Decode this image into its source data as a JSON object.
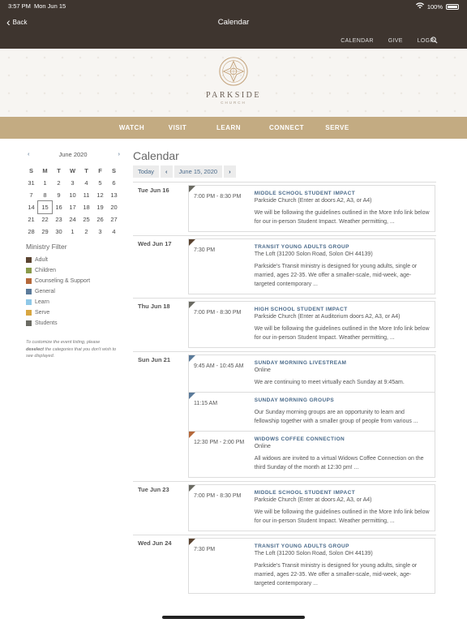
{
  "status": {
    "time": "3:57 PM",
    "date": "Mon Jun 15",
    "battery": "100%"
  },
  "nav": {
    "back_label": "Back",
    "title": "Calendar"
  },
  "toplinks": [
    "CALENDAR",
    "GIVE",
    "LOGIN"
  ],
  "brand": {
    "name": "PARKSIDE",
    "sub": "CHURCH"
  },
  "mainnav": [
    "WATCH",
    "VISIT",
    "LEARN",
    "CONNECT",
    "SERVE"
  ],
  "mini_calendar": {
    "month": "June 2020",
    "dow": [
      "S",
      "M",
      "T",
      "W",
      "T",
      "F",
      "S"
    ],
    "weeks": [
      [
        "31",
        "1",
        "2",
        "3",
        "4",
        "5",
        "6"
      ],
      [
        "7",
        "8",
        "9",
        "10",
        "11",
        "12",
        "13"
      ],
      [
        "14",
        "15",
        "16",
        "17",
        "18",
        "19",
        "20"
      ],
      [
        "21",
        "22",
        "23",
        "24",
        "25",
        "26",
        "27"
      ],
      [
        "28",
        "29",
        "30",
        "1",
        "2",
        "3",
        "4"
      ]
    ],
    "selected": "15"
  },
  "filter": {
    "title": "Ministry Filter",
    "items": [
      {
        "label": "Adult",
        "color": "#5a4330"
      },
      {
        "label": "Children",
        "color": "#8a9a4a"
      },
      {
        "label": "Counseling & Support",
        "color": "#b5683a"
      },
      {
        "label": "General",
        "color": "#5a7a9a"
      },
      {
        "label": "Learn",
        "color": "#8fc8e8"
      },
      {
        "label": "Serve",
        "color": "#d8a640"
      },
      {
        "label": "Students",
        "color": "#6a6a62"
      }
    ],
    "note_before": "To customize the event listing, please ",
    "note_bold": "deselect",
    "note_after": " the categories that you don't wish to see displayed."
  },
  "calendar": {
    "title": "Calendar",
    "today_label": "Today",
    "date_label": "June 15, 2020",
    "days": [
      {
        "label": "Tue Jun 16",
        "events": [
          {
            "time": "7:00 PM - 8:30 PM",
            "name": "MIDDLE SCHOOL STUDENT IMPACT",
            "loc": "Parkside Church (Enter at doors A2, A3, or A4)",
            "desc": "We will be following the guidelines outlined in the More Info link below for our in-person Student Impact. Weather permitting, ...",
            "color": "#6a6a62"
          }
        ]
      },
      {
        "label": "Wed Jun 17",
        "events": [
          {
            "time": "7:30 PM",
            "name": "TRANSIT YOUNG ADULTS GROUP",
            "loc": "The Loft (31200 Solon Road, Solon OH 44139)",
            "desc": "Parkside's Transit ministry is designed for young adults, single or married, ages 22-35. We offer a smaller-scale, mid-week, age-targeted contemporary ...",
            "color": "#5a4330"
          }
        ]
      },
      {
        "label": "Thu Jun 18",
        "events": [
          {
            "time": "7:00 PM - 8:30 PM",
            "name": "HIGH SCHOOL STUDENT IMPACT",
            "loc": "Parkside Church (Enter at Auditorium doors A2, A3, or A4)",
            "desc": "We will be following the guidelines outlined in the More Info link below for our in-person Student Impact. Weather permitting, ...",
            "color": "#6a6a62"
          }
        ]
      },
      {
        "label": "Sun Jun 21",
        "events": [
          {
            "time": "9:45 AM - 10:45 AM",
            "name": "SUNDAY MORNING LIVESTREAM",
            "loc": "Online",
            "desc": "We are continuing to meet virtually each Sunday at 9:45am.",
            "color": "#5a7a9a"
          },
          {
            "time": "11:15 AM",
            "name": "SUNDAY MORNING GROUPS",
            "loc": "",
            "desc": "Our Sunday morning groups are an opportunity to learn and fellowship together with a smaller group of people from various ...",
            "color": "#5a7a9a"
          },
          {
            "time": "12:30 PM - 2:00 PM",
            "name": "WIDOWS COFFEE CONNECTION",
            "loc": "Online",
            "desc": "All widows are invited to a virtual Widows Coffee Connection on the third Sunday of the month at 12:30 pm! ...",
            "color": "#b5683a"
          }
        ]
      },
      {
        "label": "Tue Jun 23",
        "events": [
          {
            "time": "7:00 PM - 8:30 PM",
            "name": "MIDDLE SCHOOL STUDENT IMPACT",
            "loc": "Parkside Church (Enter at doors A2, A3, or A4)",
            "desc": "We will be following the guidelines outlined in the More Info link below for our in-person Student Impact. Weather permitting, ...",
            "color": "#6a6a62"
          }
        ]
      },
      {
        "label": "Wed Jun 24",
        "events": [
          {
            "time": "7:30 PM",
            "name": "TRANSIT YOUNG ADULTS GROUP",
            "loc": "The Loft (31200 Solon Road, Solon OH 44139)",
            "desc": "Parkside's Transit ministry is designed for young adults, single or married, ages 22-35. We offer a smaller-scale, mid-week, age-targeted contemporary ...",
            "color": "#5a4330"
          }
        ]
      }
    ]
  }
}
